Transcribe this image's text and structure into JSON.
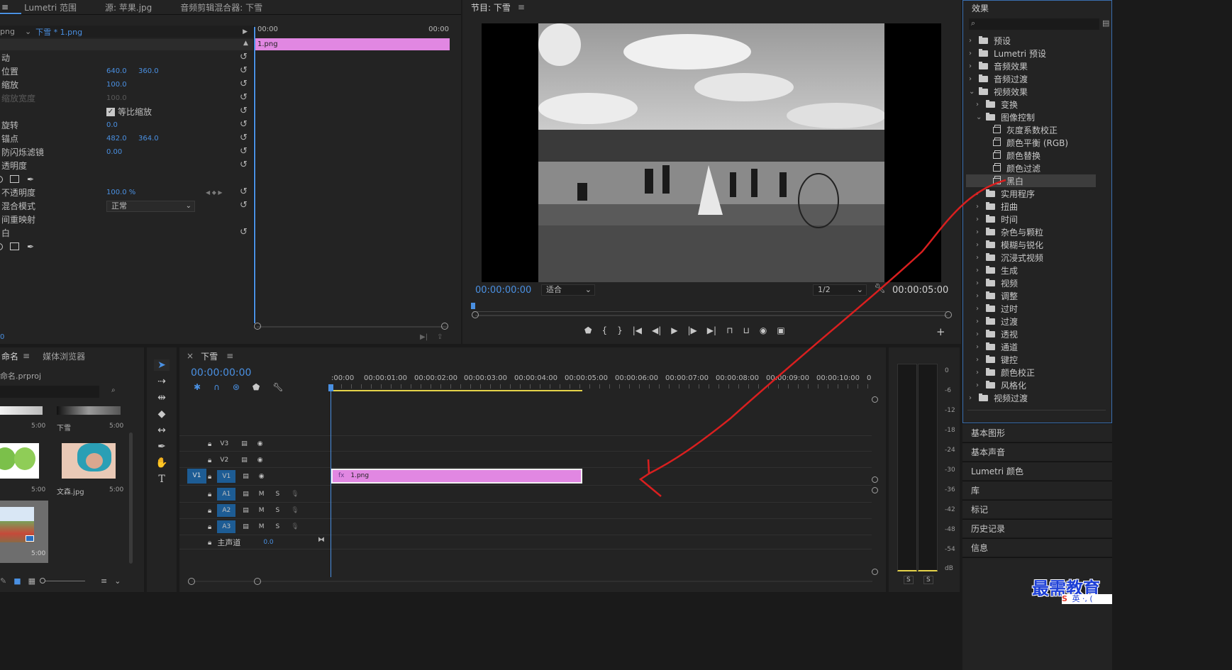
{
  "effect_controls": {
    "tabs": [
      "≡",
      "Lumetri 范围",
      "源: 苹果.jpg",
      "音频剪辑混合器: 下雪"
    ],
    "source_prefix": "png",
    "clip_name": "下雪 * 1.png",
    "time_start": "00:00",
    "time_end": "00:00",
    "clip_label": "1.png",
    "rows": [
      {
        "label": "动"
      },
      {
        "label": "位置",
        "v1": "640.0",
        "v2": "360.0"
      },
      {
        "label": "缩放",
        "v1": "100.0"
      },
      {
        "label": "缩放宽度",
        "v1": "100.0",
        "dim": true
      },
      {
        "label": "",
        "checkbox": "等比缩放"
      },
      {
        "label": "旋转",
        "v1": "0.0"
      },
      {
        "label": "锚点",
        "v1": "482.0",
        "v2": "364.0"
      },
      {
        "label": "防闪烁滤镜",
        "v1": "0.00"
      },
      {
        "label": "透明度"
      },
      {
        "label": ""
      },
      {
        "label": "不透明度",
        "v1": "100.0 %"
      },
      {
        "label": "混合模式",
        "select": "正常"
      },
      {
        "label": "间重映射"
      },
      {
        "label": "白"
      }
    ],
    "bottom_time": "0"
  },
  "program": {
    "title": "节目: 下雪",
    "timecode": "00:00:00:00",
    "fit": "适合",
    "resolution": "1/2",
    "duration": "00:00:05:00"
  },
  "effects": {
    "title": "效果",
    "search_placeholder": "",
    "tree": [
      {
        "label": "预设",
        "level": 0,
        "icon": "folder",
        "arrow": "›"
      },
      {
        "label": "Lumetri 预设",
        "level": 0,
        "icon": "folder",
        "arrow": "›"
      },
      {
        "label": "音频效果",
        "level": 0,
        "icon": "folder",
        "arrow": "›"
      },
      {
        "label": "音频过渡",
        "level": 0,
        "icon": "folder",
        "arrow": "›"
      },
      {
        "label": "视频效果",
        "level": 0,
        "icon": "folder",
        "arrow": "⌄"
      },
      {
        "label": "变换",
        "level": 1,
        "icon": "folder",
        "arrow": "›"
      },
      {
        "label": "图像控制",
        "level": 1,
        "icon": "folder",
        "arrow": "⌄"
      },
      {
        "label": "灰度系数校正",
        "level": 2,
        "icon": "fx",
        "arrow": ""
      },
      {
        "label": "颜色平衡 (RGB)",
        "level": 2,
        "icon": "fx",
        "arrow": ""
      },
      {
        "label": "颜色替换",
        "level": 2,
        "icon": "fx",
        "arrow": ""
      },
      {
        "label": "颜色过滤",
        "level": 2,
        "icon": "fx",
        "arrow": ""
      },
      {
        "label": "黑白",
        "level": 2,
        "icon": "fx",
        "arrow": "",
        "selected": true
      },
      {
        "label": "实用程序",
        "level": 1,
        "icon": "folder",
        "arrow": "›"
      },
      {
        "label": "扭曲",
        "level": 1,
        "icon": "folder",
        "arrow": "›"
      },
      {
        "label": "时间",
        "level": 1,
        "icon": "folder",
        "arrow": "›"
      },
      {
        "label": "杂色与颗粒",
        "level": 1,
        "icon": "folder",
        "arrow": "›"
      },
      {
        "label": "模糊与锐化",
        "level": 1,
        "icon": "folder",
        "arrow": "›"
      },
      {
        "label": "沉浸式视频",
        "level": 1,
        "icon": "folder",
        "arrow": "›"
      },
      {
        "label": "生成",
        "level": 1,
        "icon": "folder",
        "arrow": "›"
      },
      {
        "label": "视频",
        "level": 1,
        "icon": "folder",
        "arrow": "›"
      },
      {
        "label": "调整",
        "level": 1,
        "icon": "folder",
        "arrow": "›"
      },
      {
        "label": "过时",
        "level": 1,
        "icon": "folder",
        "arrow": "›"
      },
      {
        "label": "过渡",
        "level": 1,
        "icon": "folder",
        "arrow": "›"
      },
      {
        "label": "透视",
        "level": 1,
        "icon": "folder",
        "arrow": "›"
      },
      {
        "label": "通道",
        "level": 1,
        "icon": "folder",
        "arrow": "›"
      },
      {
        "label": "键控",
        "level": 1,
        "icon": "folder",
        "arrow": "›"
      },
      {
        "label": "颜色校正",
        "level": 1,
        "icon": "folder",
        "arrow": "›"
      },
      {
        "label": "风格化",
        "level": 1,
        "icon": "folder",
        "arrow": "›"
      },
      {
        "label": "视频过渡",
        "level": 0,
        "icon": "folder",
        "arrow": "›"
      }
    ],
    "side_panels": [
      "基本图形",
      "基本声音",
      "Lumetri 颜色",
      "库",
      "标记",
      "历史记录",
      "信息"
    ]
  },
  "project": {
    "tabs": [
      "命名",
      "媒体浏览器"
    ],
    "file": "命名.prproj",
    "items": [
      {
        "name": "",
        "duration": "5:00"
      },
      {
        "name": "下雪",
        "duration": "5:00"
      },
      {
        "name": "",
        "duration": "5:00"
      },
      {
        "name": "文森.jpg",
        "duration": "5:00"
      },
      {
        "name": "",
        "duration": "5:00"
      }
    ]
  },
  "timeline": {
    "title": "下雪",
    "timecode": "00:00:00:00",
    "ruler": [
      ":00:00",
      "00:00:01:00",
      "00:00:02:00",
      "00:00:03:00",
      "00:00:04:00",
      "00:00:05:00",
      "00:00:06:00",
      "00:00:07:00",
      "00:00:08:00",
      "00:00:09:00",
      "00:00:10:00",
      "0"
    ],
    "video_tracks": [
      "V3",
      "V2",
      "V1"
    ],
    "audio_tracks": [
      "A1",
      "A2",
      "A3"
    ],
    "source_patch": "V1",
    "master_label": "主声道",
    "master_value": "0.0",
    "clip_label": "1.png",
    "track_m": "M",
    "track_s": "S"
  },
  "meter": {
    "labels": [
      "0",
      "-6",
      "-12",
      "-18",
      "-24",
      "-30",
      "-36",
      "-42",
      "-48",
      "-54",
      "dB"
    ],
    "solo": [
      "S",
      "S"
    ]
  },
  "watermark": {
    "text": "最需教育",
    "ime": "英 ·, ("
  }
}
